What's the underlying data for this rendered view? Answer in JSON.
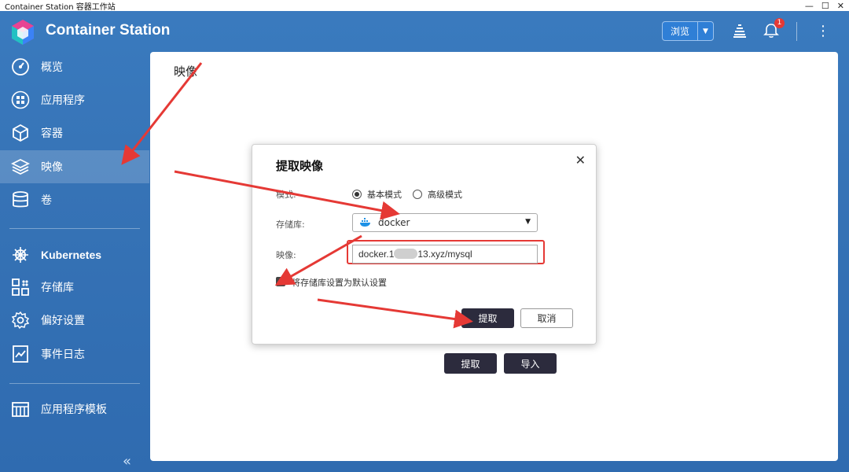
{
  "window": {
    "title": "Container Station 容器工作站"
  },
  "header": {
    "app_name": "Container Station",
    "browse_label": "浏览",
    "notification_count": "1"
  },
  "sidebar": {
    "items": [
      {
        "label": "概览",
        "icon": "dashboard-icon"
      },
      {
        "label": "应用程序",
        "icon": "apps-icon"
      },
      {
        "label": "容器",
        "icon": "cube-icon"
      },
      {
        "label": "映像",
        "icon": "layers-icon",
        "active": true
      },
      {
        "label": "卷",
        "icon": "database-icon"
      },
      {
        "label": "Kubernetes",
        "icon": "helm-wheel-icon"
      },
      {
        "label": "存储库",
        "icon": "repository-icon"
      },
      {
        "label": "偏好设置",
        "icon": "gear-icon"
      },
      {
        "label": "事件日志",
        "icon": "log-icon"
      },
      {
        "label": "应用程序模板",
        "icon": "template-icon"
      }
    ],
    "collapse_glyph": "«"
  },
  "main": {
    "title": "映像",
    "pull_button": "提取",
    "import_button": "导入"
  },
  "dialog": {
    "title": "提取映像",
    "close_glyph": "✕",
    "mode_label": "模式:",
    "mode_basic": "基本模式",
    "mode_advanced": "高级模式",
    "repository_label": "存储库:",
    "repository_value": "docker",
    "image_label": "映像:",
    "image_value_prefix": "docker.1",
    "image_value_suffix": "13.xyz/mysql",
    "default_checkbox_label": "将存储库设置为默认设置",
    "pull_button": "提取",
    "cancel_button": "取消"
  },
  "colors": {
    "accent": "#2f7fd6",
    "primary_button": "#2c2b3d",
    "annotation_red": "#e53935"
  }
}
